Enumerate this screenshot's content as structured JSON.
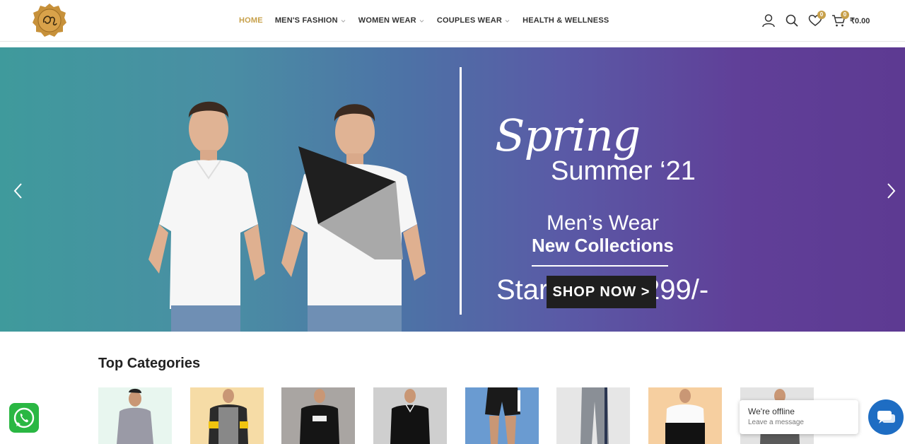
{
  "header": {
    "logo_icon": "brand-monogram-logo",
    "nav": [
      {
        "label": "HOME",
        "active": true,
        "dropdown": false
      },
      {
        "label": "MEN'S FASHION",
        "active": false,
        "dropdown": true
      },
      {
        "label": "WOMEN WEAR",
        "active": false,
        "dropdown": true
      },
      {
        "label": "COUPLES WEAR",
        "active": false,
        "dropdown": true
      },
      {
        "label": "HEALTH & WELLNESS",
        "active": false,
        "dropdown": false
      }
    ],
    "icons": {
      "account": "user-icon",
      "search": "search-icon",
      "wishlist": "heart-icon",
      "cart": "cart-icon"
    },
    "wishlist_count": "0",
    "cart_count": "0",
    "cart_total": "₹0.00"
  },
  "hero": {
    "spring": "Spring",
    "summer": "Summer ‘21",
    "menswear": "Men’s Wear",
    "new_collections": "New Collections",
    "starting": "Starting Rs.299/-",
    "cta": "SHOP NOW >"
  },
  "categories": {
    "title": "Top Categories",
    "items": [
      {
        "name": "category-tshirt-grey",
        "bg": "#e8f6ef"
      },
      {
        "name": "category-jacket",
        "bg": "#f6dca6"
      },
      {
        "name": "category-printed-tee",
        "bg": "#a9a5a2"
      },
      {
        "name": "category-polo",
        "bg": "#cfcfcf"
      },
      {
        "name": "category-shorts",
        "bg": "#6a9bd1"
      },
      {
        "name": "category-trackpants",
        "bg": "#e6e6e6"
      },
      {
        "name": "category-hoodie",
        "bg": "#f6cfa0"
      },
      {
        "name": "category-casual",
        "bg": "#e3e3e3"
      }
    ]
  },
  "chat": {
    "title": "We're offline",
    "subtitle": "Leave a message"
  },
  "colors": {
    "accent": "#c7a04a",
    "whatsapp": "#2ab743",
    "chat": "#1e6dc3"
  }
}
